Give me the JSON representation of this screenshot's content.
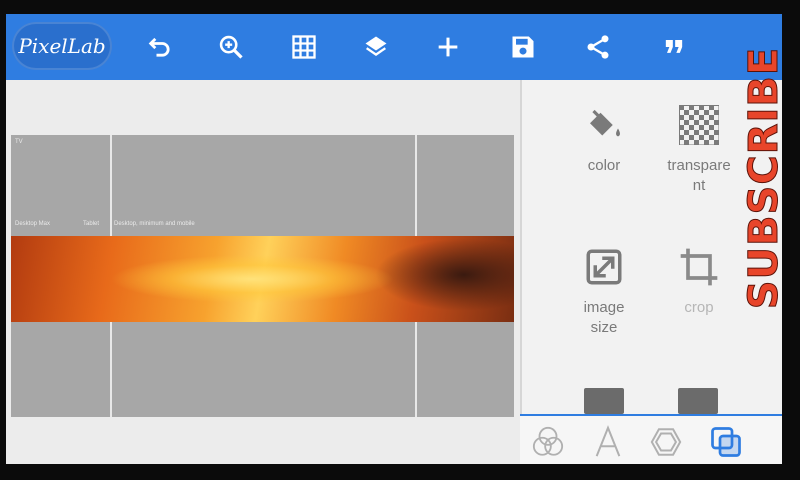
{
  "app": {
    "logo_text": "PixelLab",
    "accent_color": "#2f7de1"
  },
  "toolbar": {
    "buttons": [
      {
        "name": "undo",
        "icon": "undo-icon"
      },
      {
        "name": "zoom",
        "icon": "zoom-in-icon"
      },
      {
        "name": "grid",
        "icon": "grid-icon"
      },
      {
        "name": "layers",
        "icon": "layers-icon"
      },
      {
        "name": "add",
        "icon": "plus-icon"
      },
      {
        "name": "save",
        "icon": "save-icon"
      },
      {
        "name": "share",
        "icon": "share-icon"
      },
      {
        "name": "quote",
        "icon": "quote-icon"
      }
    ]
  },
  "canvas": {
    "guide_labels": [
      "TV",
      "Desktop Max",
      "Tablet",
      "Desktop, minimum and mobile"
    ]
  },
  "panel": {
    "tools": [
      {
        "label": "color",
        "icon": "paint-bucket-icon"
      },
      {
        "label": "transparent",
        "icon": "checkerboard-icon"
      },
      {
        "label": "image size",
        "icon": "resize-icon"
      },
      {
        "label": "crop",
        "icon": "crop-icon"
      }
    ]
  },
  "bottom_tabs": [
    {
      "name": "effects",
      "icon": "rgb-circles-icon"
    },
    {
      "name": "text",
      "icon": "text-a-icon"
    },
    {
      "name": "shapes",
      "icon": "hexagon-icon"
    },
    {
      "name": "layers",
      "icon": "overlap-squares-icon"
    }
  ],
  "overlay": {
    "subscribe_text": "SUBSCRIBE"
  }
}
